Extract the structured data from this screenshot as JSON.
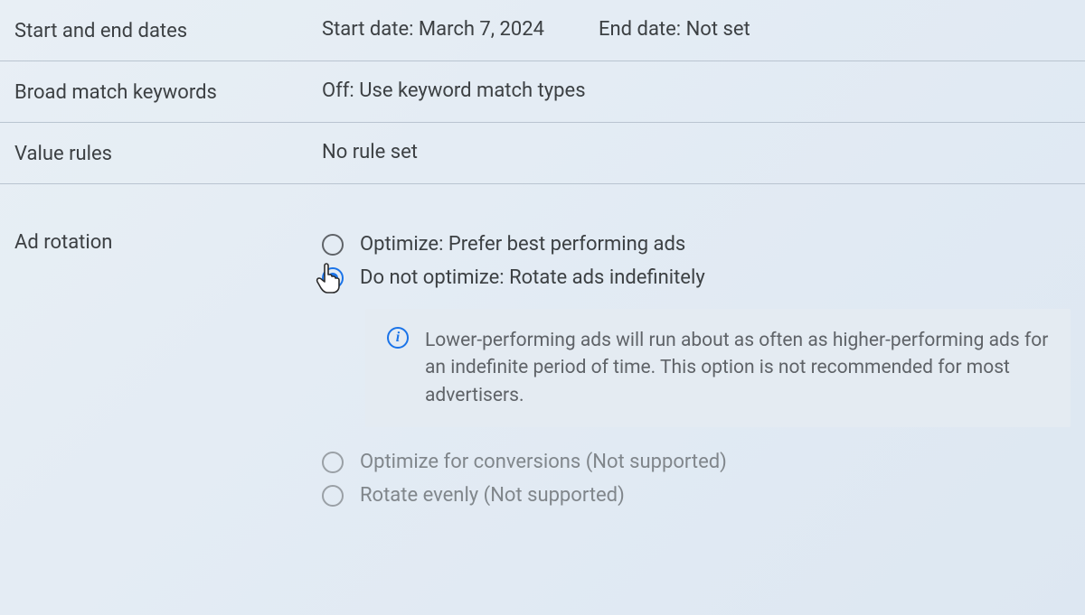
{
  "rows": {
    "dates": {
      "label": "Start and end dates",
      "start": "Start date: March 7, 2024",
      "end": "End date: Not set"
    },
    "broad": {
      "label": "Broad match keywords",
      "value": "Off: Use keyword match types"
    },
    "valueRules": {
      "label": "Value rules",
      "value": "No rule set"
    },
    "rotation": {
      "label": "Ad rotation",
      "options": {
        "optimize": "Optimize: Prefer best performing ads",
        "noOptimize": "Do not optimize: Rotate ads indefinitely",
        "conversions": "Optimize for conversions (Not supported)",
        "evenly": "Rotate evenly (Not supported)"
      },
      "info": "Lower-performing ads will run about as often as higher-performing ads for an indefinite period of time. This option is not recommended for most advertisers."
    }
  }
}
